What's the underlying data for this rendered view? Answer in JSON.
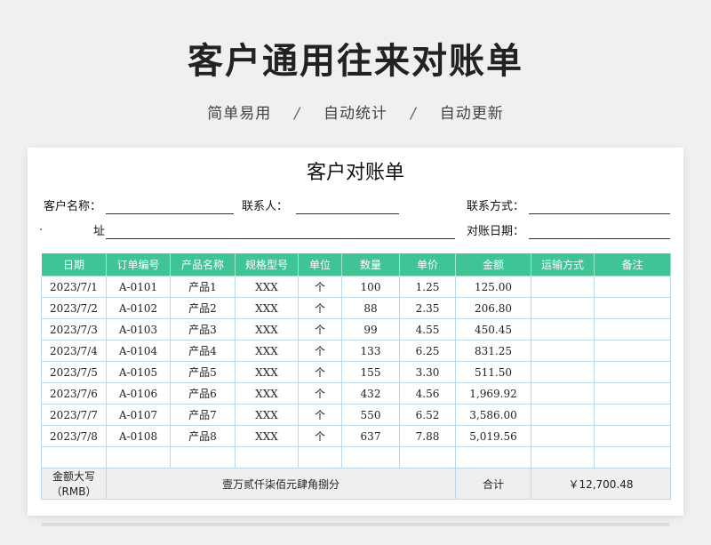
{
  "header": {
    "title": "客户通用往来对账单",
    "tags": [
      "简单易用",
      "自动统计",
      "自动更新"
    ],
    "separator": "/"
  },
  "sheet": {
    "title": "客户对账单",
    "fields": {
      "customer_name_label": "客户名称：",
      "contact_person_label": "联系人：",
      "contact_method_label": "联系方式：",
      "address_label": "址",
      "statement_date_label": "对账日期："
    },
    "columns": [
      "日期",
      "订单编号",
      "产品名称",
      "规格型号",
      "单位",
      "数量",
      "单价",
      "金额",
      "运输方式",
      "备注"
    ],
    "rows": [
      [
        "2023/7/1",
        "A-0101",
        "产品1",
        "XXX",
        "个",
        "100",
        "1.25",
        "125.00",
        "",
        ""
      ],
      [
        "2023/7/2",
        "A-0102",
        "产品2",
        "XXX",
        "个",
        "88",
        "2.35",
        "206.80",
        "",
        ""
      ],
      [
        "2023/7/3",
        "A-0103",
        "产品3",
        "XXX",
        "个",
        "99",
        "4.55",
        "450.45",
        "",
        ""
      ],
      [
        "2023/7/4",
        "A-0104",
        "产品4",
        "XXX",
        "个",
        "133",
        "6.25",
        "831.25",
        "",
        ""
      ],
      [
        "2023/7/5",
        "A-0105",
        "产品5",
        "XXX",
        "个",
        "155",
        "3.30",
        "511.50",
        "",
        ""
      ],
      [
        "2023/7/6",
        "A-0106",
        "产品6",
        "XXX",
        "个",
        "432",
        "4.56",
        "1,969.92",
        "",
        ""
      ],
      [
        "2023/7/7",
        "A-0107",
        "产品7",
        "XXX",
        "个",
        "550",
        "6.52",
        "3,586.00",
        "",
        ""
      ],
      [
        "2023/7/8",
        "A-0108",
        "产品8",
        "XXX",
        "个",
        "637",
        "7.88",
        "5,019.56",
        "",
        ""
      ],
      [
        "",
        "",
        "",
        "",
        "",
        "",
        "",
        "",
        "",
        ""
      ]
    ],
    "total": {
      "amount_words_label": "金额大写（RMB）",
      "amount_words": "壹万贰仟柒佰元肆角捌分",
      "sum_label": "合计",
      "sum_value": "￥12,700.48"
    },
    "header_color": "#3fc495",
    "grid_color": "#b9d9ea"
  }
}
